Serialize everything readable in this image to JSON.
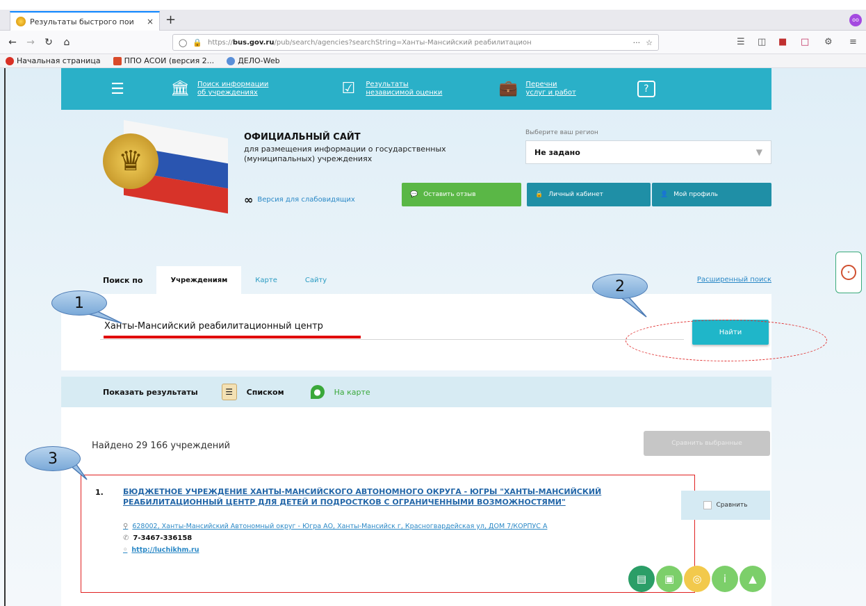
{
  "browser": {
    "tab_title": "Результаты быстрого пои",
    "tab_close": "×",
    "new_tab": "+",
    "url_prefix": "https://",
    "url_domain": "bus.gov.ru",
    "url_rest": "/pub/search/agencies?searchString=Ханты-Мансийский реабилитацион",
    "url_menu": "···",
    "bookmarks": [
      "Начальная страница",
      "ППО АСОИ (версия 2...",
      "ДЕЛО-Web"
    ]
  },
  "topnav": {
    "items": [
      {
        "line1": "Поиск информации",
        "line2": "об учреждениях"
      },
      {
        "line1": "Результаты",
        "line2": "независимой оценки"
      },
      {
        "line1": "Перечни",
        "line2": "услуг и работ"
      }
    ]
  },
  "header": {
    "site_title": "ОФИЦИАЛЬНЫЙ САЙТ",
    "site_desc": "для размещения информации о государственных (муниципальных) учреждениях",
    "low_vision": "Версия для слабовидящих",
    "region_label": "Выберите ваш регион",
    "region_value": "Не задано",
    "btn_feedback": "Оставить отзыв",
    "btn_cabinet": "Личный кабинет",
    "btn_profile": "Мой профиль"
  },
  "search": {
    "by_label": "Поиск по",
    "tabs": [
      "Учреждениям",
      "Карте",
      "Сайту"
    ],
    "advanced": "Расширенный поиск",
    "query": "Ханты-Мансийский реабилитационный центр",
    "find_button": "Найти"
  },
  "results": {
    "show_label": "Показать результаты",
    "list_label": "Списком",
    "map_label": "На карте",
    "found_text": "Найдено 29 166 учреждений",
    "grey_button": "Сравнить выбранные",
    "item": {
      "number": "1.",
      "title": "БЮДЖЕТНОЕ УЧРЕЖДЕНИЕ ХАНТЫ-МАНСИЙСКОГО АВТОНОМНОГО ОКРУГА - ЮГРЫ \"ХАНТЫ-МАНСИЙСКИЙ РЕАБИЛИТАЦИОННЫЙ ЦЕНТР ДЛЯ ДЕТЕЙ И ПОДРОСТКОВ С ОГРАНИЧЕННЫМИ ВОЗМОЖНОСТЯМИ\"",
      "address": "628002, Ханты-Мансийский Автономный округ - Югра АО, Ханты-Мансийск г, Красногвардейская ул, ДОМ 7/КОРПУС А",
      "phone": "7-3467-336158",
      "site": "http://luchikhm.ru",
      "compare": "Сравнить"
    }
  },
  "annotations": [
    "1",
    "2",
    "3"
  ],
  "colors": {
    "nav": "#2ab0c8",
    "feedback": "#5ab746",
    "cabinet": "#1f8fa6",
    "find": "#1fb6c9",
    "red_mark": "#e00000"
  }
}
